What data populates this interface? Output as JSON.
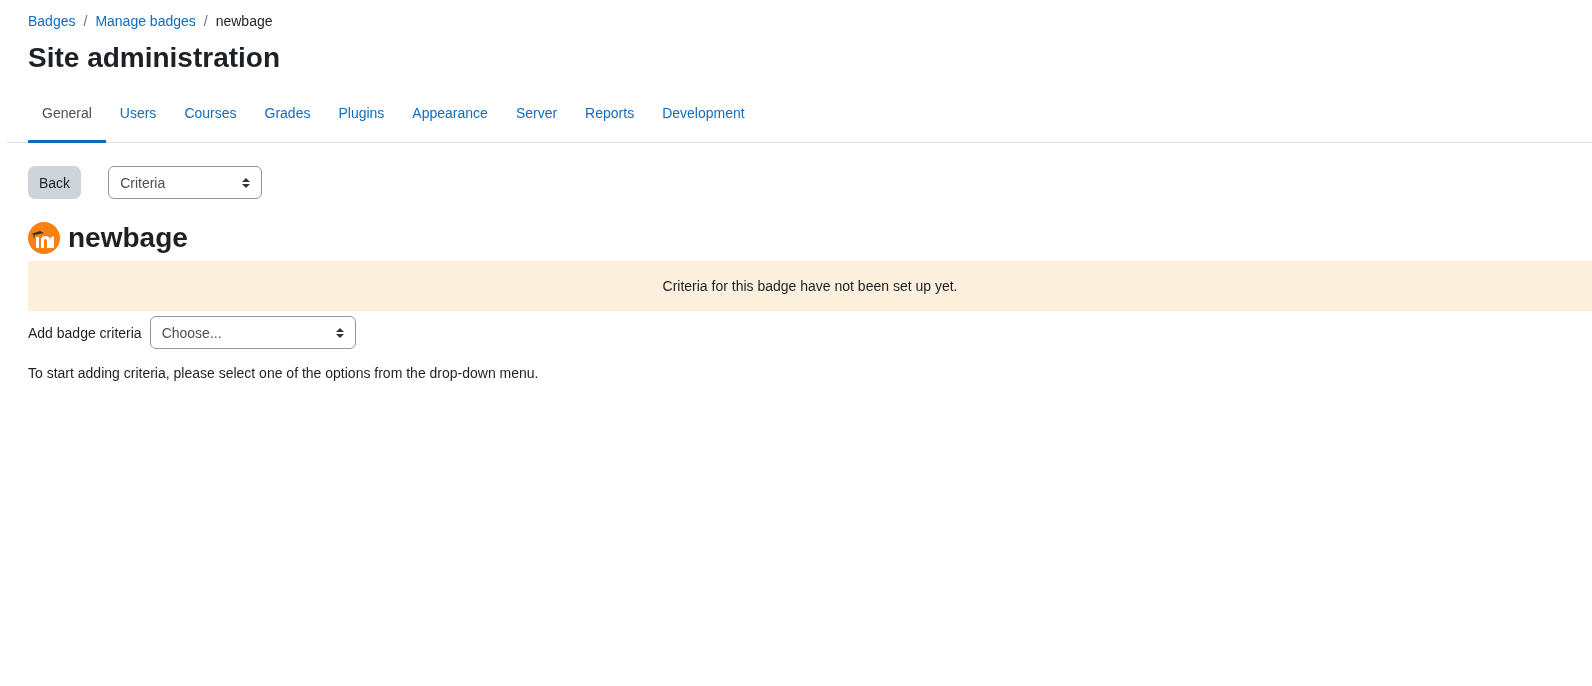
{
  "breadcrumb": [
    {
      "label": "Badges",
      "link": true
    },
    {
      "label": "Manage badges",
      "link": true
    },
    {
      "label": "newbage",
      "link": false
    }
  ],
  "breadcrumb_separator": "/",
  "page_title": "Site administration",
  "tabs": [
    {
      "label": "General",
      "selected": true
    },
    {
      "label": "Users",
      "selected": false
    },
    {
      "label": "Courses",
      "selected": false
    },
    {
      "label": "Grades",
      "selected": false
    },
    {
      "label": "Plugins",
      "selected": false
    },
    {
      "label": "Appearance",
      "selected": false
    },
    {
      "label": "Server",
      "selected": false
    },
    {
      "label": "Reports",
      "selected": false
    },
    {
      "label": "Development",
      "selected": false
    }
  ],
  "back_button": "Back",
  "section_select": {
    "value": "Criteria"
  },
  "badge_name": "newbage",
  "alert": "Criteria for this badge have not been set up yet.",
  "criteria_select": {
    "label": "Add badge criteria",
    "placeholder": "Choose..."
  },
  "help_text": "To start adding criteria, please select one of the options from the drop-down menu."
}
